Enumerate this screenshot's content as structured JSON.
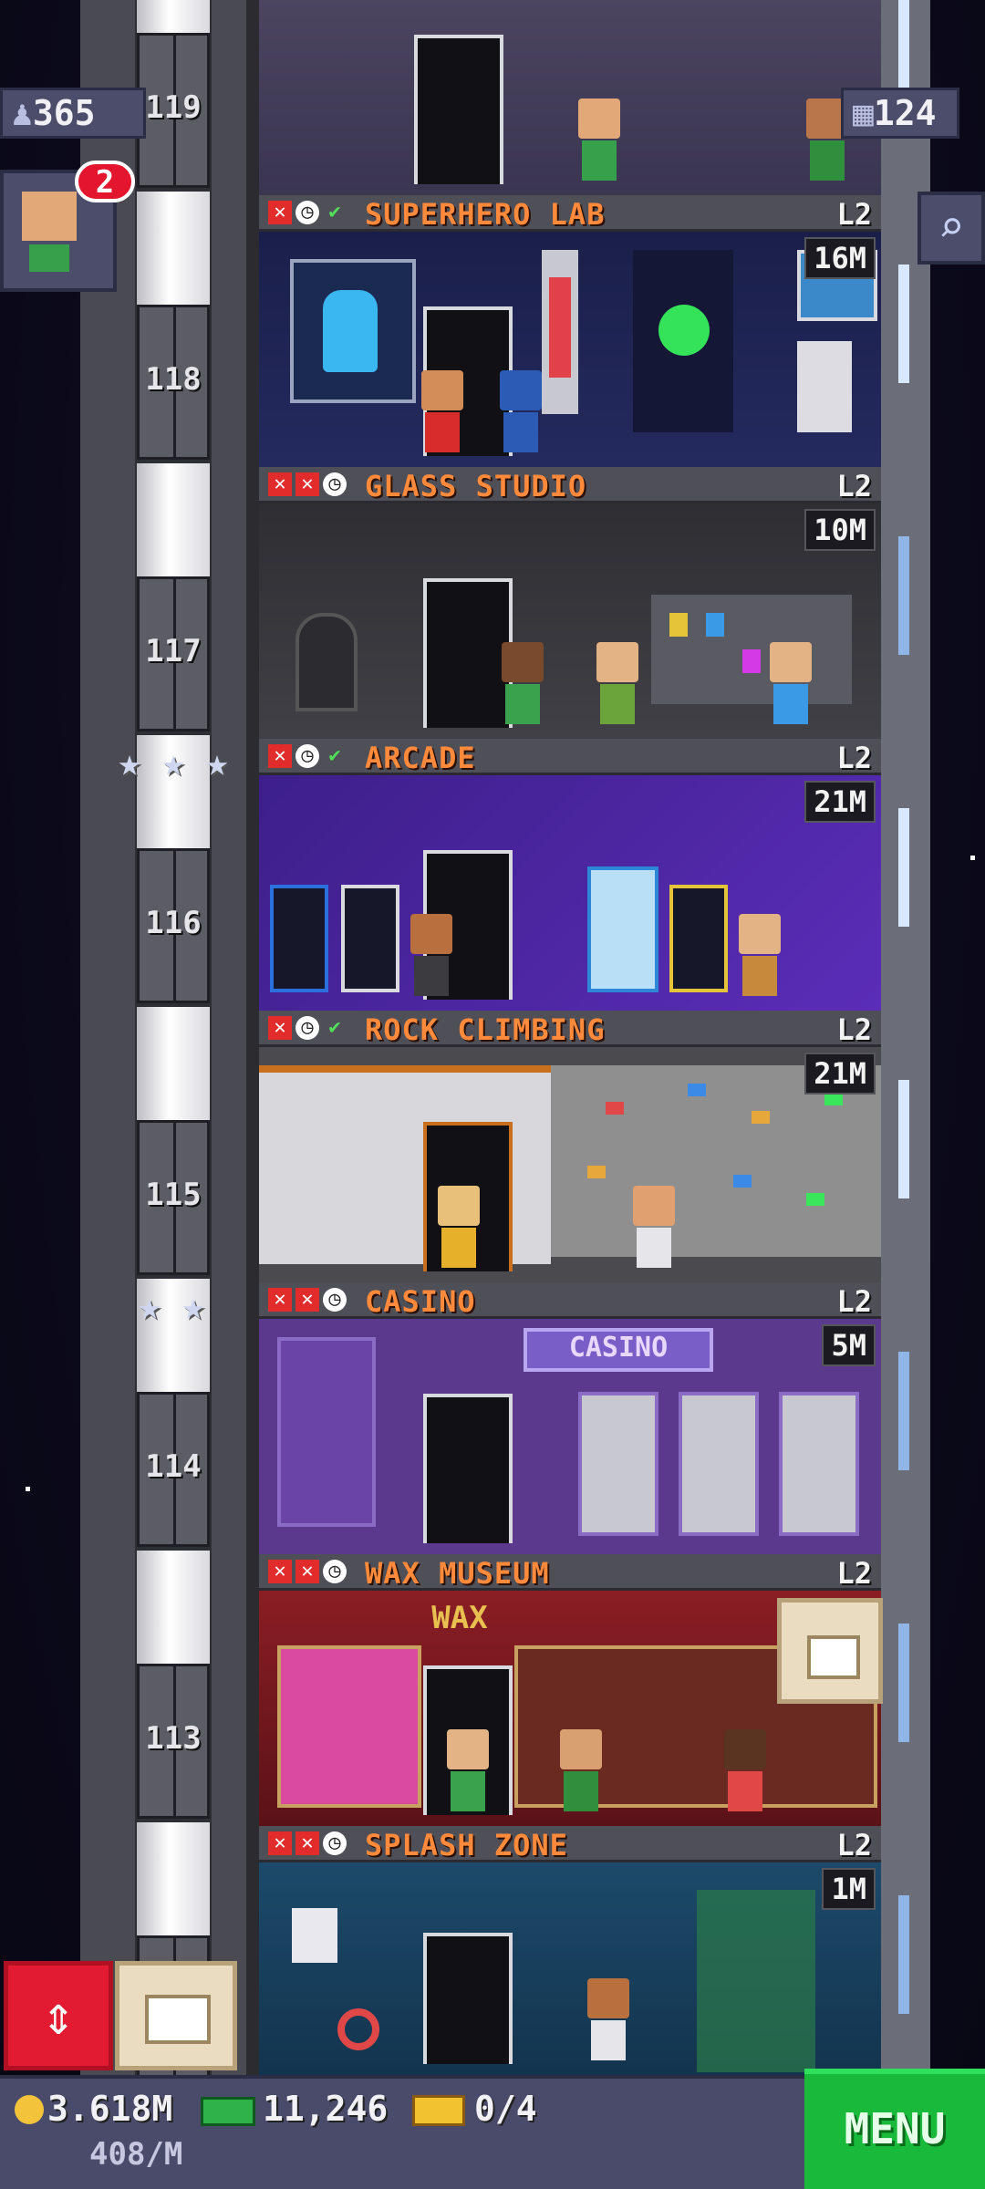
{
  "top": {
    "population": "365",
    "floors_count": "124",
    "visitor_notifications": "2"
  },
  "floors": [
    {
      "number": "119",
      "name": "",
      "level": "",
      "income": ""
    },
    {
      "number": "118",
      "name": "SUPERHERO LAB",
      "level": "L2",
      "income": "16M",
      "status": [
        "x",
        "clock",
        "check"
      ],
      "stars": 0
    },
    {
      "number": "117",
      "name": "GLASS STUDIO",
      "level": "L2",
      "income": "10M",
      "status": [
        "x",
        "x",
        "clock"
      ],
      "stars": 0
    },
    {
      "number": "116",
      "name": "ARCADE",
      "level": "L2",
      "income": "21M",
      "status": [
        "x",
        "clock",
        "check"
      ],
      "stars": 3
    },
    {
      "number": "115",
      "name": "ROCK CLIMBING",
      "level": "L2",
      "income": "21M",
      "status": [
        "x",
        "clock",
        "check"
      ],
      "stars": 0
    },
    {
      "number": "114",
      "name": "CASINO",
      "level": "L2",
      "income": "5M",
      "status": [
        "x",
        "x",
        "clock"
      ],
      "stars": 2
    },
    {
      "number": "113",
      "name": "WAX MUSEUM",
      "level": "L2",
      "income": "",
      "status": [
        "x",
        "x",
        "clock"
      ],
      "stars": 0
    },
    {
      "number": "",
      "name": "SPLASH ZONE",
      "level": "L2",
      "income": "1M",
      "status": [
        "x",
        "x",
        "clock"
      ],
      "stars": 0
    }
  ],
  "signs": {
    "casino": "CASINO",
    "wax": "WAX"
  },
  "bottom": {
    "coins": "3.618M",
    "rate": "408/M",
    "bux": "11,246",
    "tickets": "0/4",
    "menu_label": "MENU"
  },
  "icons": {
    "population": "person-icon",
    "floors": "building-icon",
    "search": "magnifier-icon",
    "elevator": "elevator-arrows-icon",
    "stock": "crate-icon",
    "coin": "coin-icon",
    "bux": "tower-bux-icon",
    "ticket": "vip-ticket-icon"
  },
  "colors": {
    "floor_name": "#ff8a3c",
    "menu_green": "#19b93b",
    "elevator_red": "#e21b32",
    "bar_bg": "#4a4b6b"
  }
}
